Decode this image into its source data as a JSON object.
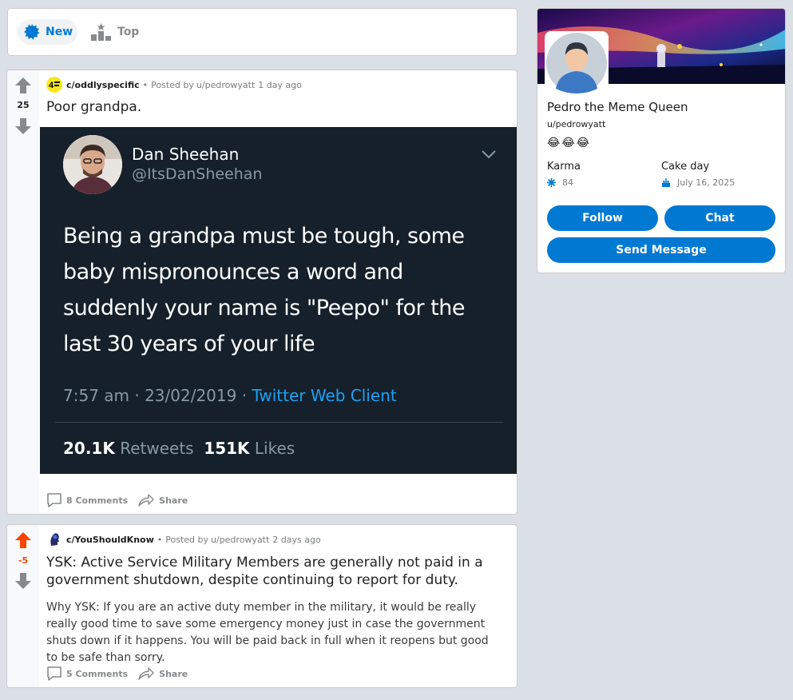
{
  "sort": {
    "new_label": "New",
    "top_label": "Top"
  },
  "posts": [
    {
      "score": "25",
      "subreddit": "c/oddlyspecific",
      "posted_by_prefix": "Posted by",
      "author": "u/pedrowyatt",
      "time": "1 day ago",
      "title": "Poor grandpa.",
      "comments": "8 Comments",
      "share": "Share",
      "vote_state": "none",
      "tweet": {
        "name": "Dan Sheehan",
        "handle": "@ItsDanSheehan",
        "text": "Being a grandpa must be tough, some baby mispronounces a word and suddenly your name is \"Peepo\" for the last 30 years of your life",
        "time": "7:57 am · 23/02/2019 · ",
        "client": "Twitter Web Client",
        "retweets_count": "20.1K",
        "retweets_label": "Retweets",
        "likes_count": "151K",
        "likes_label": "Likes"
      }
    },
    {
      "score": "-5",
      "subreddit": "c/YouShouldKnow",
      "posted_by_prefix": "Posted by",
      "author": "u/pedrowyatt",
      "time": "2 days ago",
      "title": "YSK: Active Service Military Members are generally not paid in a government shutdown, despite continuing to report for duty.",
      "body": "Why YSK: If you are an active duty member in the military, it would be really really good time to save some emergency money just in case the government shuts down if it happens. You will be paid back in full when it reopens but good to be safe than sorry.",
      "comments": "5 Comments",
      "share": "Share",
      "vote_state": "upvoted"
    }
  ],
  "profile": {
    "display_name": "Pedro the Meme Queen",
    "username": "u/pedrowyatt",
    "emojis": "😂😂😂",
    "karma_label": "Karma",
    "karma_value": "84",
    "cake_label": "Cake day",
    "cake_value": "July 16, 2025",
    "follow_label": "Follow",
    "chat_label": "Chat",
    "message_label": "Send Message"
  },
  "colors": {
    "accent": "#0079d3",
    "upvote": "#ff4500",
    "page_bg": "#dae0e6"
  }
}
